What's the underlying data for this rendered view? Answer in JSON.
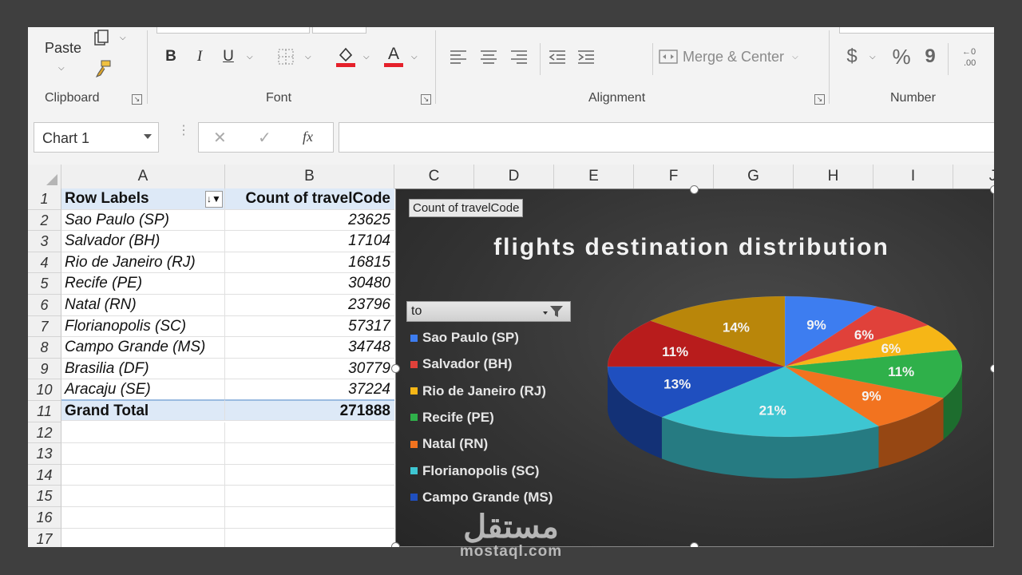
{
  "ribbon": {
    "clipboard": {
      "label": "Clipboard",
      "paste_label": "Paste"
    },
    "font": {
      "label": "Font",
      "bold": "B",
      "italic": "I",
      "underline": "U",
      "font_color_letter": "A"
    },
    "alignment": {
      "label": "Alignment",
      "merge_center": "Merge & Center"
    },
    "number": {
      "label": "Number",
      "currency": "$",
      "percent": "%",
      "comma": "9"
    }
  },
  "formula_bar": {
    "name_box": "Chart 1",
    "fx": "fx",
    "cancel": "✕",
    "enter": "✓",
    "formula": ""
  },
  "columns": [
    "A",
    "B",
    "C",
    "D",
    "E",
    "F",
    "G",
    "H",
    "I",
    "J"
  ],
  "rows": [
    "1",
    "2",
    "3",
    "4",
    "5",
    "6",
    "7",
    "8",
    "9",
    "10",
    "11",
    "12",
    "13",
    "14",
    "15",
    "16",
    "17"
  ],
  "pivot": {
    "header_a": "Row Labels",
    "header_b": "Count of travelCode",
    "entries": [
      {
        "label": "Sao Paulo (SP)",
        "value": "23625"
      },
      {
        "label": "Salvador (BH)",
        "value": "17104"
      },
      {
        "label": "Rio de Janeiro (RJ)",
        "value": "16815"
      },
      {
        "label": "Recife (PE)",
        "value": "30480"
      },
      {
        "label": "Natal (RN)",
        "value": "23796"
      },
      {
        "label": "Florianopolis (SC)",
        "value": "57317"
      },
      {
        "label": "Campo Grande (MS)",
        "value": "34748"
      },
      {
        "label": "Brasilia (DF)",
        "value": "30779"
      },
      {
        "label": "Aracaju (SE)",
        "value": "37224"
      }
    ],
    "total_label": "Grand Total",
    "total_value": "271888"
  },
  "chart_data": {
    "type": "pie",
    "title": "flights destination distribution",
    "field_button": "Count of travelCode",
    "filter_field": "to",
    "categories": [
      "Sao Paulo (SP)",
      "Salvador (BH)",
      "Rio de Janeiro (RJ)",
      "Recife (PE)",
      "Natal (RN)",
      "Florianopolis (SC)",
      "Campo Grande (MS)",
      "Brasilia (DF)",
      "Aracaju (SE)"
    ],
    "values": [
      23625,
      17104,
      16815,
      30480,
      23796,
      57317,
      34748,
      30779,
      37224
    ],
    "labels": [
      "9%",
      "6%",
      "6%",
      "11%",
      "9%",
      "21%",
      "13%",
      "11%",
      "14%"
    ],
    "colors": [
      "#3d7df0",
      "#e0413a",
      "#f6b616",
      "#2fb04a",
      "#f2731f",
      "#3ec6d2",
      "#1f4fbf",
      "#b81c1c",
      "#b9860a"
    ],
    "legend_visible": [
      "Sao Paulo (SP)",
      "Salvador (BH)",
      "Rio de Janeiro (RJ)",
      "Recife (PE)",
      "Natal (RN)",
      "Florianopolis (SC)",
      "Campo Grande (MS)"
    ],
    "legend_position": "left",
    "style": "3d"
  },
  "watermark": {
    "arabic": "مستقل",
    "latin": "mostaql.com"
  }
}
